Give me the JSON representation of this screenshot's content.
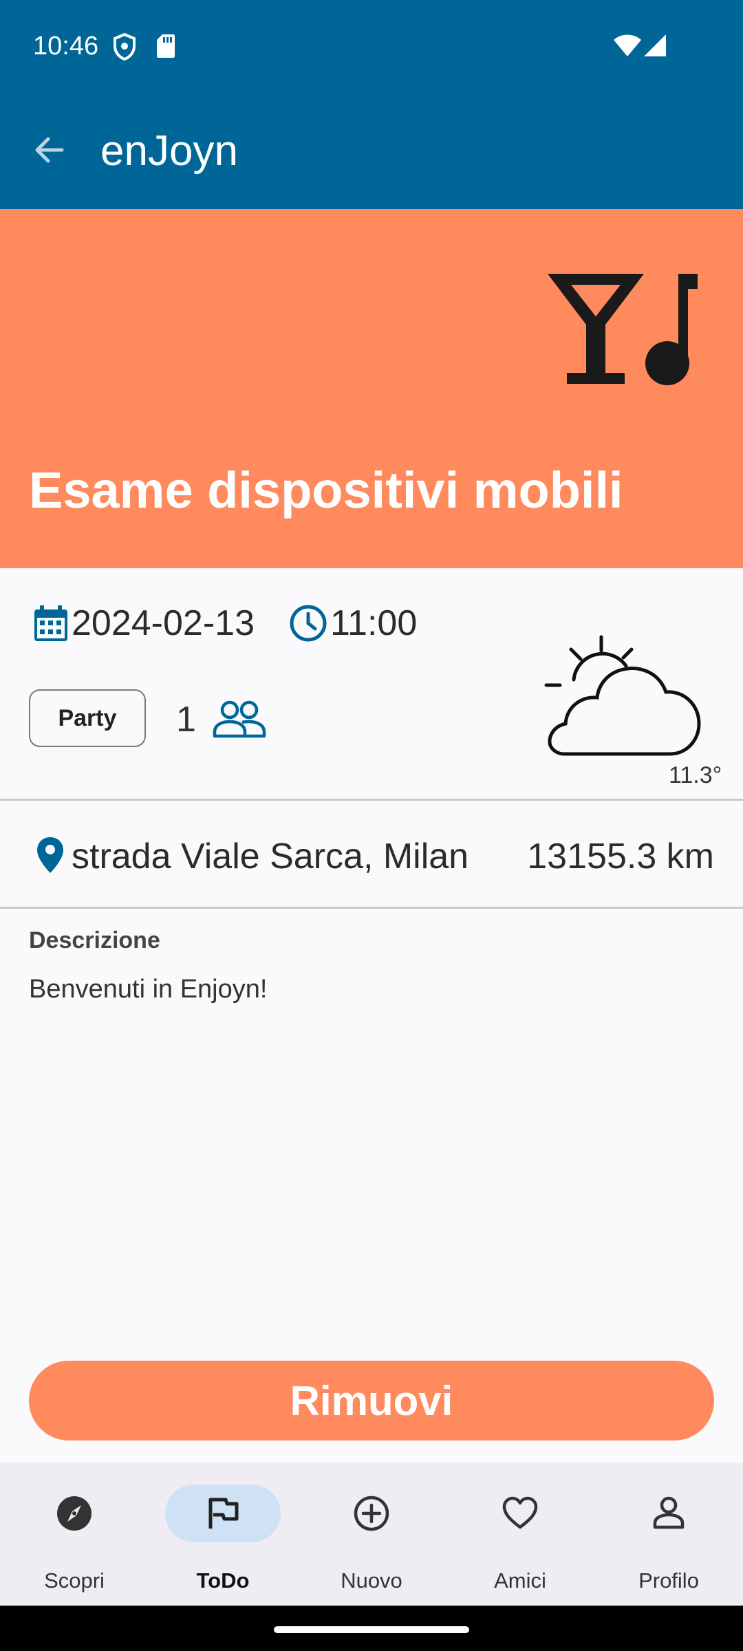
{
  "status_bar": {
    "time": "10:46",
    "icons": [
      "shield-icon",
      "sd-card-icon",
      "wifi-icon",
      "signal-icon"
    ]
  },
  "app_bar": {
    "back_icon": "arrow-back-icon",
    "logo_text": "enJoyn",
    "background_color": "#006697"
  },
  "event": {
    "title": "Esame dispositivi mobili",
    "category_icon": "cocktail-music-icon",
    "hero_color": "#ff8a5e",
    "date": "2024-02-13",
    "time": "11:00",
    "category": "Party",
    "participants": "1",
    "weather_icon": "partly-cloudy-icon",
    "temperature": "11.3°",
    "address": "strada Viale Sarca, Milan",
    "distance": "13155.3 km",
    "description_label": "Descrizione",
    "description": "Benvenuti in Enjoyn!"
  },
  "actions": {
    "remove_label": "Rimuovi"
  },
  "bottom_nav": {
    "items": [
      {
        "label": "Scopri",
        "icon": "compass-icon",
        "active": false
      },
      {
        "label": "ToDo",
        "icon": "flag-icon",
        "active": true
      },
      {
        "label": "Nuovo",
        "icon": "add-circle-icon",
        "active": false
      },
      {
        "label": "Amici",
        "icon": "heart-icon",
        "active": false
      },
      {
        "label": "Profilo",
        "icon": "person-icon",
        "active": false
      }
    ]
  }
}
